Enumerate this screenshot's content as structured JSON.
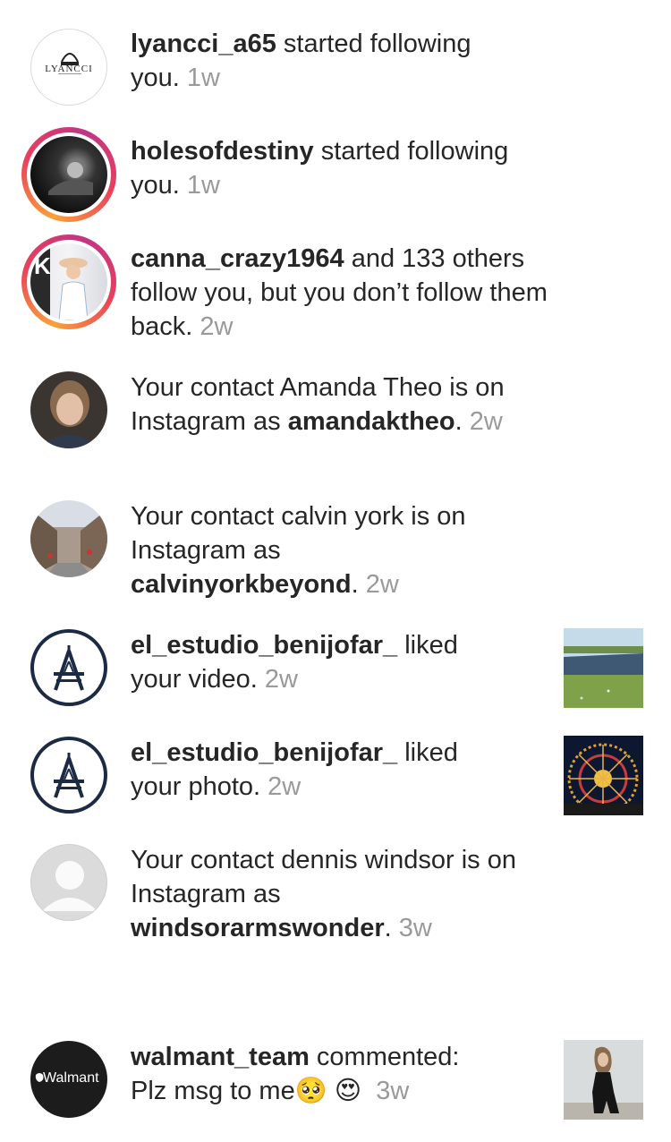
{
  "notifications": [
    {
      "username": "lyancci_a65",
      "action": " started following",
      "cont": "you.",
      "time": "1w",
      "logo_text": "LYANCCI"
    },
    {
      "username": "holesofdestiny",
      "action": " started following",
      "cont": "you.",
      "time": "1w"
    },
    {
      "username": "canna_crazy1964",
      "action": " and 133 others",
      "cont": "follow you, but you don’t follow them",
      "cont2": "back.",
      "time": "2w"
    },
    {
      "pre": "Your contact Amanda Theo is on",
      "pre2": "Instagram as ",
      "username": "amandaktheo",
      "post": ".",
      "time": "2w"
    },
    {
      "pre": "Your contact calvin york is on",
      "pre2": "Instagram as",
      "username": "calvinyorkbeyond",
      "post": ".",
      "time": "2w"
    },
    {
      "username": "el_estudio_benijofar_",
      "action": " liked",
      "cont": "your video.",
      "time": "2w"
    },
    {
      "username": "el_estudio_benijofar_",
      "action": " liked",
      "cont": "your photo.",
      "time": "2w"
    },
    {
      "pre": "Your contact dennis windsor is on",
      "pre2": "Instagram as",
      "username": "windsorarmswonder",
      "post": ".",
      "time": "3w"
    },
    {
      "username": "walmant_team",
      "action": " commented:",
      "cont": "Plz msg to me",
      "emoji1": "🥺",
      "emoji2": "😍",
      "time": "3w",
      "logo_text": "Walmant"
    }
  ]
}
